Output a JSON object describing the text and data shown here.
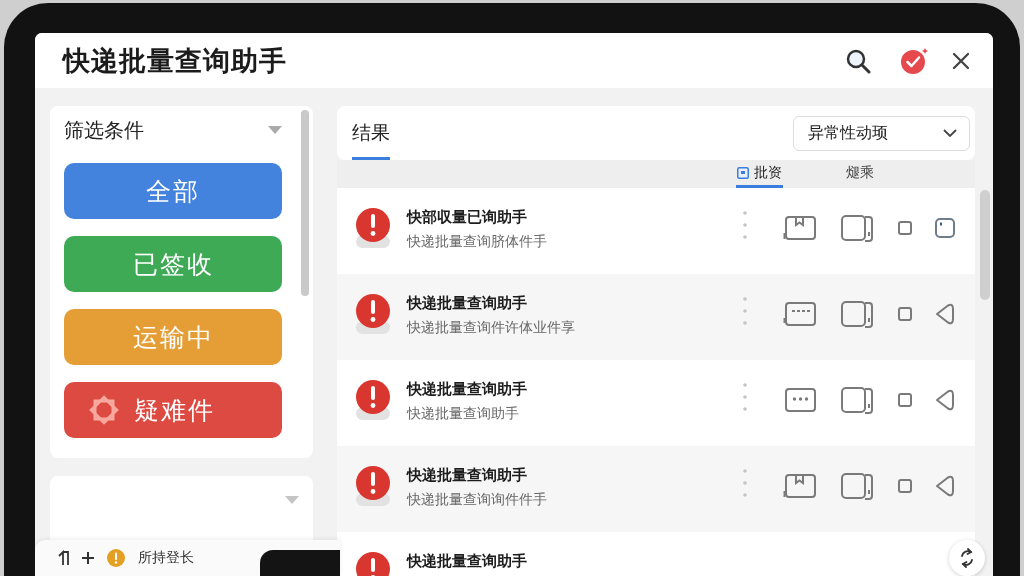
{
  "window": {
    "title": "快递批量查询助手"
  },
  "filter_panel": {
    "title": "筛选条件",
    "filters": [
      {
        "label": "全部",
        "color": "#4483dd",
        "kind": "plain"
      },
      {
        "label": "已签收",
        "color": "#3faa55",
        "kind": "plain"
      },
      {
        "label": "运输中",
        "color": "#e59e35",
        "kind": "plain"
      },
      {
        "label": "疑难件",
        "color": "#dd4a42",
        "kind": "icon"
      }
    ]
  },
  "results": {
    "tab": {
      "label": "结果",
      "selected": true
    },
    "dropdown": {
      "value": "异常性动顼"
    },
    "sub_tabs": [
      {
        "label": "批资",
        "selected": true
      },
      {
        "label": "煺乘",
        "selected": false
      }
    ],
    "rows": [
      {
        "title": "快部収量已询助手",
        "subtitle": "快递批量查询脐体件手",
        "actions": [
          {
            "kind": "package"
          },
          {
            "kind": "tablet"
          },
          {
            "kind": "square"
          },
          {
            "kind": "dot-square"
          }
        ]
      },
      {
        "title": "快递批量查询助手",
        "subtitle": "快递批量查询件许体业件享",
        "actions": [
          {
            "kind": "dash-card"
          },
          {
            "kind": "tablet"
          },
          {
            "kind": "square"
          },
          {
            "kind": "tag"
          }
        ]
      },
      {
        "title": "快递批量查询助手",
        "subtitle": "快递批量查询助手",
        "actions": [
          {
            "kind": "dots-card"
          },
          {
            "kind": "tablet"
          },
          {
            "kind": "square"
          },
          {
            "kind": "tag"
          }
        ]
      },
      {
        "title": "快递批量查询助手",
        "subtitle": "快递批量查询询件件手",
        "actions": [
          {
            "kind": "package"
          },
          {
            "kind": "tablet"
          },
          {
            "kind": "square"
          },
          {
            "kind": "tag"
          }
        ]
      },
      {
        "title": "快递批量查询助手"
      }
    ]
  },
  "bottom_bar": {
    "text": "所持登长"
  }
}
